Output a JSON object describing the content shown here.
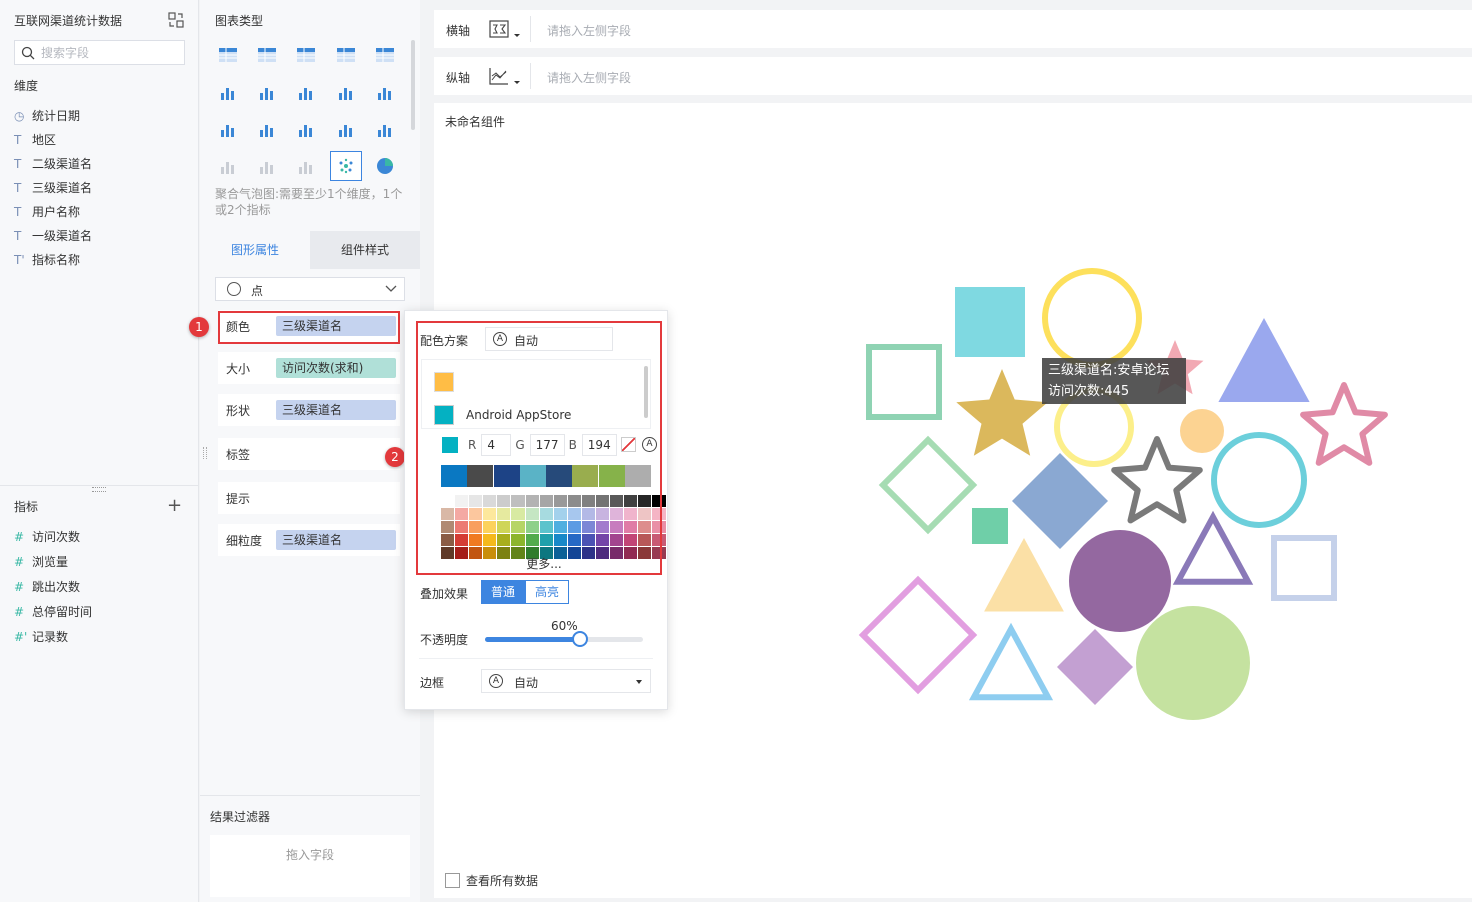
{
  "dataset": {
    "title": "互联网渠道统计数据",
    "search_placeholder": "搜索字段"
  },
  "dimensions": {
    "label": "维度",
    "fields": [
      {
        "name": "统计日期",
        "icon": "clock-icon"
      },
      {
        "name": "地区",
        "icon": "text-field-icon"
      },
      {
        "name": "二级渠道名",
        "icon": "text-field-icon"
      },
      {
        "name": "三级渠道名",
        "icon": "text-field-icon"
      },
      {
        "name": "用户名称",
        "icon": "text-field-icon"
      },
      {
        "name": "一级渠道名",
        "icon": "text-field-icon"
      },
      {
        "name": "指标名称",
        "icon": "text-field-icon"
      }
    ]
  },
  "metrics": {
    "label": "指标",
    "fields": [
      {
        "name": "访问次数"
      },
      {
        "name": "浏览量"
      },
      {
        "name": "跳出次数"
      },
      {
        "name": "总停留时间"
      },
      {
        "name": "记录数"
      }
    ]
  },
  "chart_types": {
    "title": "图表类型",
    "hint": "聚合气泡图:需要至少1个维度，1个或2个指标",
    "selected": "aggregated-bubble"
  },
  "tabs": [
    {
      "label": "图形属性",
      "active": true
    },
    {
      "label": "组件样式",
      "active": false
    }
  ],
  "mark_type": {
    "value": "点"
  },
  "props": {
    "color": {
      "label": "颜色",
      "value": "三级渠道名"
    },
    "size": {
      "label": "大小",
      "value": "访问次数(求和)"
    },
    "shape": {
      "label": "形状",
      "value": "三级渠道名"
    },
    "label": {
      "label": "标签"
    },
    "tooltip": {
      "label": "提示"
    },
    "granularity": {
      "label": "细粒度",
      "value": "三级渠道名"
    }
  },
  "badges": [
    "1",
    "2"
  ],
  "filter": {
    "title": "结果过滤器",
    "placeholder": "拖入字段"
  },
  "axes": {
    "x_label": "横轴",
    "y_label": "纵轴",
    "placeholder": "请拖入左侧字段"
  },
  "component": {
    "title": "未命名组件",
    "view_all": "查看所有数据"
  },
  "tooltip": {
    "line1": "三级渠道名:安卓论坛",
    "line2": "访问次数:445"
  },
  "color_popup": {
    "scheme_label": "配色方案",
    "scheme_value": "自动",
    "item_name": "Android AppStore",
    "r_label": "R",
    "r_value": "4",
    "g_label": "G",
    "g_value": "177",
    "b_label": "B",
    "b_value": "194",
    "auto_glyph": "A",
    "more": "更多...",
    "blend_label": "叠加效果",
    "blend_normal": "普通",
    "blend_highlight": "高亮",
    "opacity_label": "不透明度",
    "opacity_value": "60%",
    "opacity_fraction": 0.6,
    "border_label": "边框",
    "border_value": "自动",
    "main_colors": [
      "#0a78c2",
      "#4a4a4a",
      "#1d4386",
      "#5ab3c6",
      "#264a7a",
      "#99ad4e",
      "#86b24a",
      "#adadad"
    ],
    "palette": [
      [
        "#ffffff",
        "#f2f2f2",
        "#e6e6e6",
        "#d9d9d9",
        "#cccccc",
        "#bfbfbf",
        "#b3b3b3",
        "#a6a6a6",
        "#999999",
        "#8c8c8c",
        "#808080",
        "#737373",
        "#595959",
        "#404040",
        "#262626",
        "#000000"
      ],
      [
        "#d9b8a6",
        "#f4a9a3",
        "#fcc79e",
        "#fde89c",
        "#e6ea9f",
        "#d8eaa2",
        "#c5e6c3",
        "#a7dbe0",
        "#a3d1ec",
        "#a7c7ee",
        "#b3b9e6",
        "#c8b4e0",
        "#dfb4da",
        "#f0b4cc",
        "#eec5c5",
        "#f5b5c5"
      ],
      [
        "#b08a73",
        "#ec7a72",
        "#f99f5e",
        "#fcd25c",
        "#cfd559",
        "#b6d566",
        "#8ed08a",
        "#5cc3cc",
        "#4fafe0",
        "#5c9be3",
        "#7c87d6",
        "#a27bcd",
        "#c77cbe",
        "#e07ca6",
        "#dd8d8d",
        "#e98fa6"
      ],
      [
        "#8a5c45",
        "#d43c34",
        "#f07a21",
        "#f5b91c",
        "#a8ae1e",
        "#8cb52c",
        "#52ab4d",
        "#1fa0ab",
        "#1888c8",
        "#2669c5",
        "#4b53b4",
        "#7445a8",
        "#a2458f",
        "#c24576",
        "#b85858",
        "#c85a74"
      ],
      [
        "#5f3a28",
        "#a41d18",
        "#c25510",
        "#c98e0a",
        "#7c8112",
        "#628418",
        "#2f7c2c",
        "#0d7780",
        "#0c6197",
        "#134596",
        "#2d3288",
        "#4e2a7e",
        "#782b6a",
        "#912a52",
        "#8a3838",
        "#973a51"
      ]
    ]
  },
  "bubbles": [
    {
      "shape": "square",
      "fill": true,
      "color": "#7fd9e1"
    },
    {
      "shape": "circle",
      "fill": false,
      "color": "#fde05c"
    },
    {
      "shape": "star",
      "fill": true,
      "color": "#f2a9b3"
    },
    {
      "shape": "triangle",
      "fill": true,
      "color": "#9aa8ee"
    },
    {
      "shape": "square",
      "fill": false,
      "color": "#8fd3b3"
    },
    {
      "shape": "star",
      "fill": true,
      "color": "#dbb85c"
    },
    {
      "shape": "circle",
      "fill": false,
      "color": "#fcef8a"
    },
    {
      "shape": "circle",
      "fill": true,
      "color": "#fcd392"
    },
    {
      "shape": "star",
      "fill": false,
      "color": "#e08aa6"
    },
    {
      "shape": "diamond",
      "fill": false,
      "color": "#a6dcb3"
    },
    {
      "shape": "diamond",
      "fill": true,
      "color": "#8aa8d2"
    },
    {
      "shape": "star",
      "fill": false,
      "color": "#7a7a7a"
    },
    {
      "shape": "circle",
      "fill": false,
      "color": "#6ccfdb"
    },
    {
      "shape": "square",
      "fill": true,
      "color": "#6fcfa8"
    },
    {
      "shape": "triangle",
      "fill": true,
      "color": "#fbe0a6"
    },
    {
      "shape": "circle",
      "fill": true,
      "color": "#9468a0"
    },
    {
      "shape": "triangle",
      "fill": false,
      "color": "#8a79b8"
    },
    {
      "shape": "square",
      "fill": false,
      "color": "#c5d1ea"
    },
    {
      "shape": "diamond",
      "fill": false,
      "color": "#e29ee0"
    },
    {
      "shape": "triangle",
      "fill": false,
      "color": "#8ecdf0"
    },
    {
      "shape": "diamond",
      "fill": true,
      "color": "#c3a0d2"
    },
    {
      "shape": "circle",
      "fill": true,
      "color": "#c5e2a0"
    }
  ]
}
